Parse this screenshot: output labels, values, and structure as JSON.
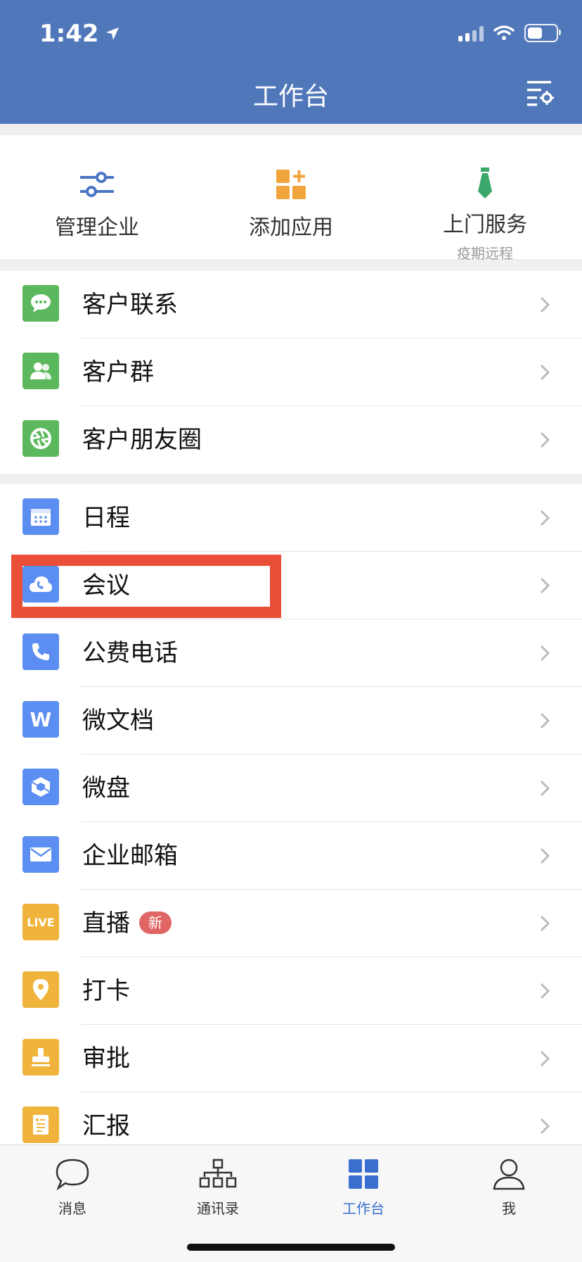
{
  "status_bar": {
    "time": "1:42"
  },
  "header": {
    "title": "工作台"
  },
  "quick_actions": [
    {
      "label": "管理企业",
      "sub": ""
    },
    {
      "label": "添加应用",
      "sub": ""
    },
    {
      "label": "上门服务",
      "sub": "疫期远程"
    }
  ],
  "customer_apps": [
    {
      "label": "客户联系",
      "icon": "chat-bubble-icon",
      "color": "#5cb85c"
    },
    {
      "label": "客户群",
      "icon": "people-icon",
      "color": "#5cb85c"
    },
    {
      "label": "客户朋友圈",
      "icon": "aperture-icon",
      "color": "#5cb85c"
    }
  ],
  "work_apps": [
    {
      "label": "日程",
      "icon": "calendar-icon",
      "color": "#5b8ef0"
    },
    {
      "label": "会议",
      "icon": "cloud-phone-icon",
      "color": "#5b8ef0"
    },
    {
      "label": "公费电话",
      "icon": "phone-icon",
      "color": "#5b8ef0"
    },
    {
      "label": "微文档",
      "icon": "w-doc-icon",
      "color": "#5b8ef0",
      "glyph": "W"
    },
    {
      "label": "微盘",
      "icon": "cube-drive-icon",
      "color": "#5b8ef0"
    },
    {
      "label": "企业邮箱",
      "icon": "mail-icon",
      "color": "#5b8ef0"
    },
    {
      "label": "直播",
      "icon": "live-icon",
      "color": "#f0b43c",
      "glyph": "LIVE",
      "badge": "新"
    },
    {
      "label": "打卡",
      "icon": "location-pin-icon",
      "color": "#f0b43c"
    },
    {
      "label": "审批",
      "icon": "stamp-icon",
      "color": "#f0b43c"
    },
    {
      "label": "汇报",
      "icon": "report-icon",
      "color": "#f0b43c"
    }
  ],
  "tabs": [
    {
      "label": "消息",
      "icon": "message-icon",
      "active": false
    },
    {
      "label": "通讯录",
      "icon": "org-chart-icon",
      "active": false
    },
    {
      "label": "工作台",
      "icon": "grid-icon",
      "active": true
    },
    {
      "label": "我",
      "icon": "person-icon",
      "active": false
    }
  ],
  "colors": {
    "header_bg": "#5077ba",
    "green_app": "#5cb85c",
    "blue_app": "#5b8ef0",
    "yellow_app": "#f0b43c",
    "highlight": "#e94e36",
    "active_tab": "#3a6fd0"
  }
}
